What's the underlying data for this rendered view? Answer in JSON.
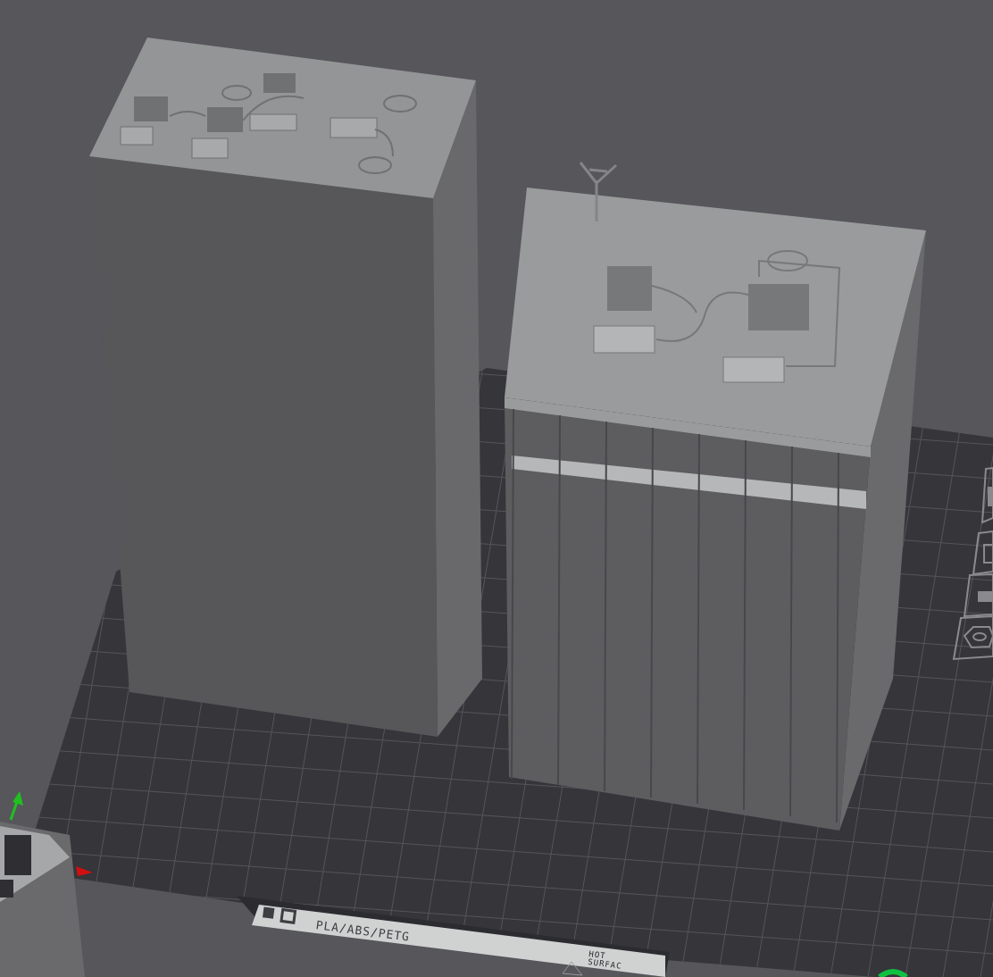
{
  "viewport": {
    "bed_label": {
      "material": "PLA/ABS/PETG",
      "warning": [
        "HOT",
        "SURFAC"
      ]
    }
  }
}
